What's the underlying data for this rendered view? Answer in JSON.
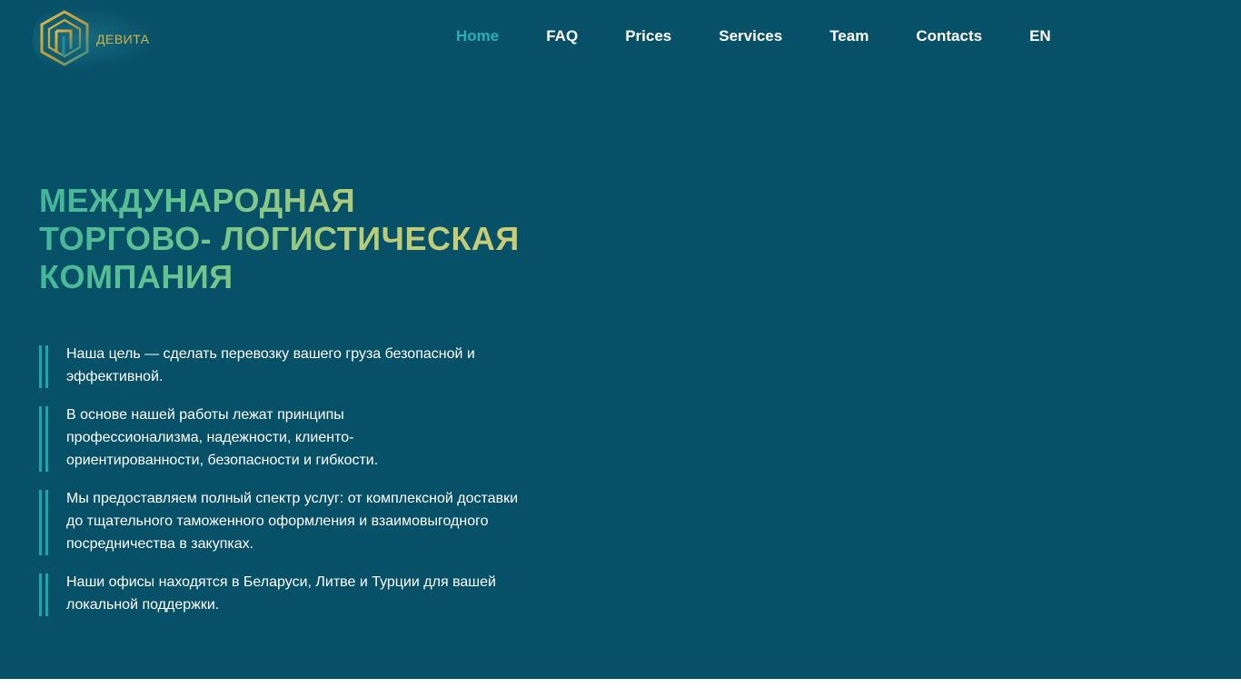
{
  "brand": {
    "name": "ДЕВИТА",
    "logo_colors": {
      "gold": "#d4b347",
      "teal": "#1f8f9a"
    }
  },
  "nav": {
    "items": [
      {
        "label": "Home",
        "active": true
      },
      {
        "label": "FAQ"
      },
      {
        "label": "Prices"
      },
      {
        "label": "Services"
      },
      {
        "label": "Team"
      },
      {
        "label": "Contacts"
      },
      {
        "label": "EN"
      }
    ]
  },
  "hero": {
    "title_lines": [
      "МЕЖДУНАРОДНАЯ",
      "ТОРГОВО- ЛОГИСТИЧЕСКАЯ",
      "КОМПАНИЯ"
    ],
    "points": [
      "Наша цель — сделать перевозку вашего груза безопасной и эффективной.",
      "В основе нашей работы лежат принципы профессионализма, надежности, клиенто-ориентированности, безопасности и гибкости.",
      "Мы предоставляем полный спектр услуг: от комплексной доставки до тщательного таможенного оформления и взаимовыгодного посредничества в закупках.",
      "Наши офисы находятся в Беларуси, Литве и Турции для вашей локальной поддержки."
    ]
  },
  "colors": {
    "background": "#065068",
    "nav_active": "#2ab0b4",
    "accent_bar": "#1aa8a8",
    "title_gradient_start": "#3fb59b",
    "title_gradient_end": "#d5cd73"
  }
}
